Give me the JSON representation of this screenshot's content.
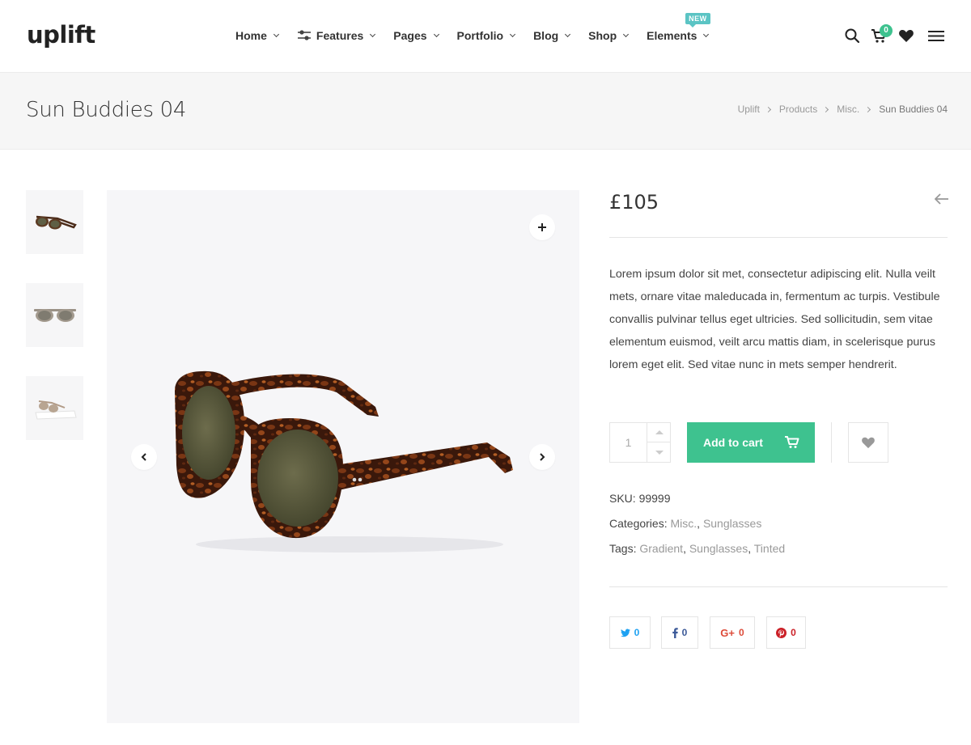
{
  "brand": {
    "logo_text": "uplift",
    "accent_color": "#3ec28f"
  },
  "nav": {
    "items": [
      {
        "label": "Home"
      },
      {
        "label": "Features",
        "icon": "features-icon"
      },
      {
        "label": "Pages"
      },
      {
        "label": "Portfolio"
      },
      {
        "label": "Blog"
      },
      {
        "label": "Shop"
      },
      {
        "label": "Elements",
        "badge": "NEW"
      }
    ]
  },
  "header_icons": {
    "search": "search-icon",
    "cart": "cart-icon",
    "cart_count": "0",
    "wishlist": "heart-icon",
    "menu": "hamburger-icon"
  },
  "page": {
    "title": "Sun Buddies 04",
    "breadcrumb": [
      "Uplift",
      "Products",
      "Misc.",
      "Sun Buddies 04"
    ]
  },
  "product": {
    "price": "£105",
    "description": "Lorem ipsum dolor sit met, consectetur adipiscing elit. Nulla veilt mets, ornare vitae maleducada in, fermentum ac turpis. Vestibule convallis pulvinar tellus eget ultricies. Sed sollicitudin, sem vitae elementum euismod, veilt arcu mattis diam, in scelerisque purus lorem eget elit. Sed vitae nunc in mets semper hendrerit.",
    "quantity": "1",
    "add_to_cart_label": "Add to cart",
    "sku_label": "SKU:",
    "sku": "99999",
    "categories_label": "Categories:",
    "categories": [
      "Misc.",
      "Sunglasses"
    ],
    "tags_label": "Tags:",
    "tags": [
      "Gradient",
      "Sunglasses",
      "Tinted"
    ]
  },
  "share": [
    {
      "network": "twitter",
      "icon": "twitter-icon",
      "count": "0",
      "color": "#1da1f2"
    },
    {
      "network": "facebook",
      "icon": "facebook-icon",
      "count": "0",
      "color": "#3b5998"
    },
    {
      "network": "google-plus",
      "icon": "google-plus-icon",
      "count": "0",
      "color": "#dd4b39"
    },
    {
      "network": "pinterest",
      "icon": "pinterest-icon",
      "count": "0",
      "color": "#cb2027"
    }
  ]
}
